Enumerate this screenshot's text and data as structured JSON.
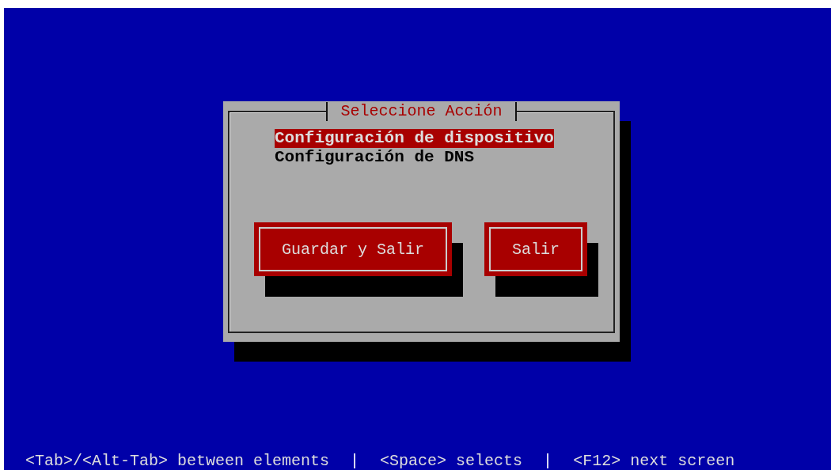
{
  "dialog": {
    "title": "Seleccione Acción",
    "items": [
      {
        "label": "Configuración de dispositivo",
        "selected": true
      },
      {
        "label": "Configuración de DNS",
        "selected": false
      }
    ],
    "buttons": [
      {
        "label": "Guardar y Salir"
      },
      {
        "label": "Salir"
      }
    ]
  },
  "help_bar": [
    {
      "kind": "hint",
      "text": "<Tab>/<Alt-Tab> between elements"
    },
    {
      "kind": "separator",
      "text": "|"
    },
    {
      "kind": "hint",
      "text": "<Space> selects"
    },
    {
      "kind": "separator",
      "text": "|"
    },
    {
      "kind": "hint",
      "text": "<F12> next screen"
    }
  ]
}
